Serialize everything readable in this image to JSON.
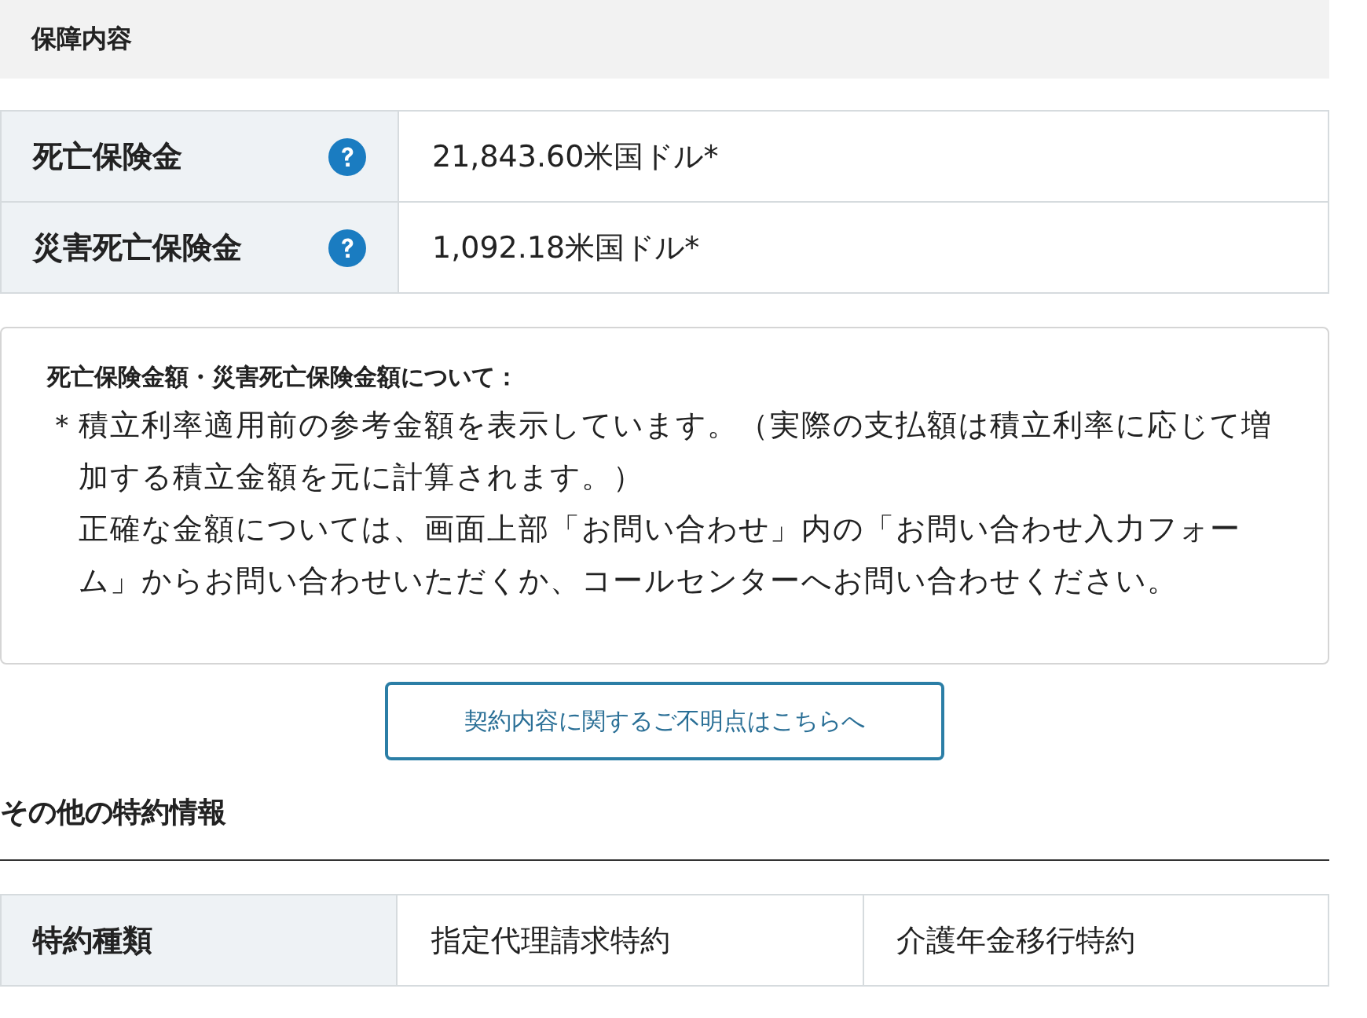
{
  "section": {
    "title": "保障内容"
  },
  "coverage": {
    "rows": [
      {
        "label": "死亡保険金",
        "help": true,
        "value": "21,843.60米国ドル*"
      },
      {
        "label": "災害死亡保険金",
        "help": true,
        "value": "1,092.18米国ドル*"
      }
    ]
  },
  "note": {
    "title": "死亡保険金額・災害死亡保険金額について：",
    "marker": "＊",
    "paragraphs": [
      "積立利率適用前の参考金額を表示しています。（実際の支払額は積立利率に応じて増加する積立金額を元に計算されます。）",
      "正確な金額については、画面上部「お問い合わせ」内の「お問い合わせ入力フォーム」からお問い合わせいただくか、コールセンターへお問い合わせください。"
    ]
  },
  "inquiry_button": {
    "label": "契約内容に関するご不明点はこちらへ"
  },
  "riders": {
    "title": "その他の特約情報",
    "rows": [
      {
        "label": "特約種類",
        "values": [
          "指定代理請求特約",
          "介護年金移行特約"
        ]
      }
    ]
  }
}
